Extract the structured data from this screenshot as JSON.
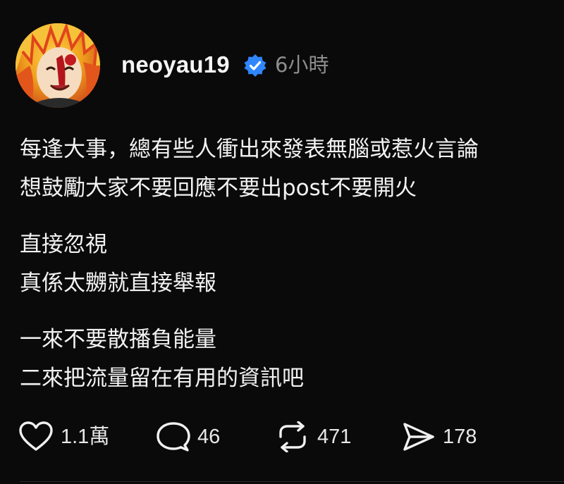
{
  "author": {
    "username": "neoyau19",
    "verified": true,
    "time_ago": "6小時",
    "avatar_icon": "anime-character-avatar"
  },
  "post": {
    "paragraphs": [
      [
        "每逢大事，總有些人衝出來發表無腦或惹火言論",
        "想鼓勵大家不要回應不要出post不要開火"
      ],
      [
        "直接忽視",
        "真係太嬲就直接舉報"
      ],
      [
        "一來不要散播負能量",
        "二來把流量留在有用的資訊吧"
      ]
    ]
  },
  "actions": {
    "like": {
      "icon": "heart-icon",
      "count": "1.1萬"
    },
    "reply": {
      "icon": "comment-icon",
      "count": "46"
    },
    "repost": {
      "icon": "repost-icon",
      "count": "471"
    },
    "share": {
      "icon": "send-icon",
      "count": "178"
    }
  },
  "colors": {
    "background": "#0a0a0a",
    "text": "#f2f2f2",
    "muted": "#8d8d8d",
    "verified_blue": "#2f86ff"
  }
}
